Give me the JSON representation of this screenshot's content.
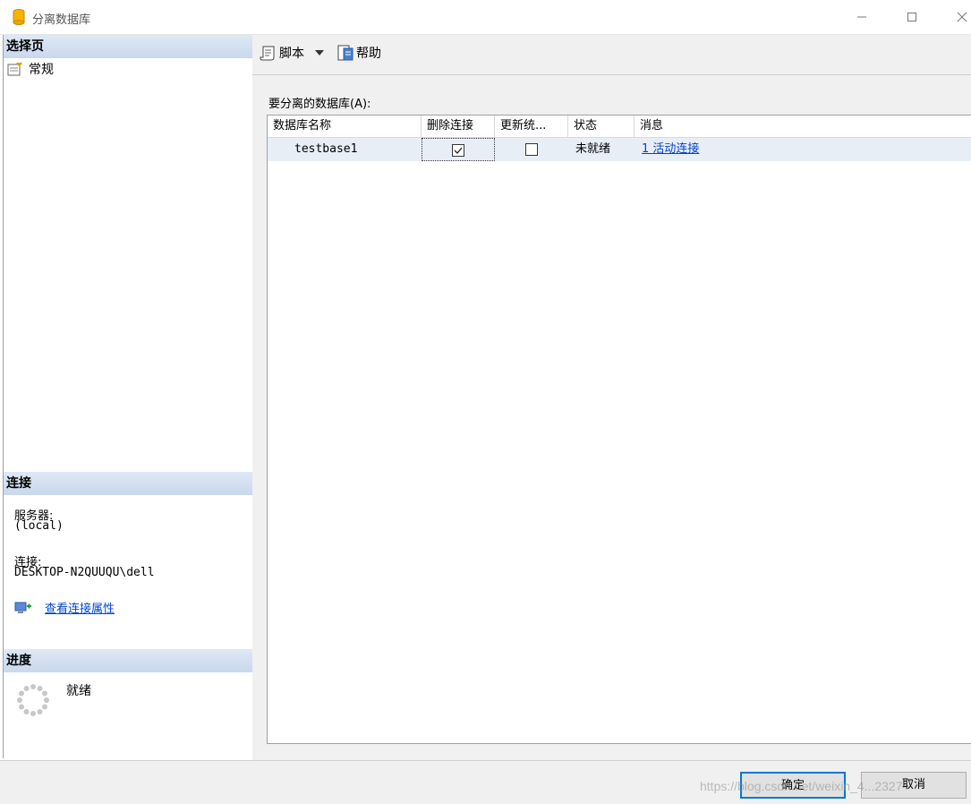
{
  "window": {
    "title": "分离数据库",
    "controls": [
      "minimize",
      "maximize",
      "close"
    ]
  },
  "left_panel": {
    "select_page": {
      "header": "选择页",
      "items": [
        {
          "label": "常规",
          "icon": "general-page-icon"
        }
      ]
    },
    "connection": {
      "header": "连接",
      "server_label": "服务器:",
      "server_value": "(local)",
      "connection_label": "连接:",
      "connection_value": "DESKTOP-N2QUUQU\\dell",
      "view_props_link": "查看连接属性"
    },
    "progress": {
      "header": "进度",
      "status": "就绪"
    }
  },
  "toolbar": {
    "script_label": "脚本",
    "help_label": "帮助"
  },
  "grid": {
    "label": "要分离的数据库(A):",
    "columns": [
      "数据库名称",
      "删除连接",
      "更新统...",
      "状态",
      "消息"
    ],
    "rows": [
      {
        "name": "testbase1",
        "drop_connections": true,
        "update_stats": false,
        "status": "未就绪",
        "message": "1 活动连接"
      }
    ]
  },
  "buttons": {
    "ok": "确定",
    "cancel": "取消"
  },
  "watermark": "https://blog.csdn.net/weixin_4...2327",
  "colors": {
    "header_bg": "#dfe8f5",
    "link": "#0044cc",
    "selected_row": "#e8eef6",
    "ok_border": "#0078d7"
  }
}
